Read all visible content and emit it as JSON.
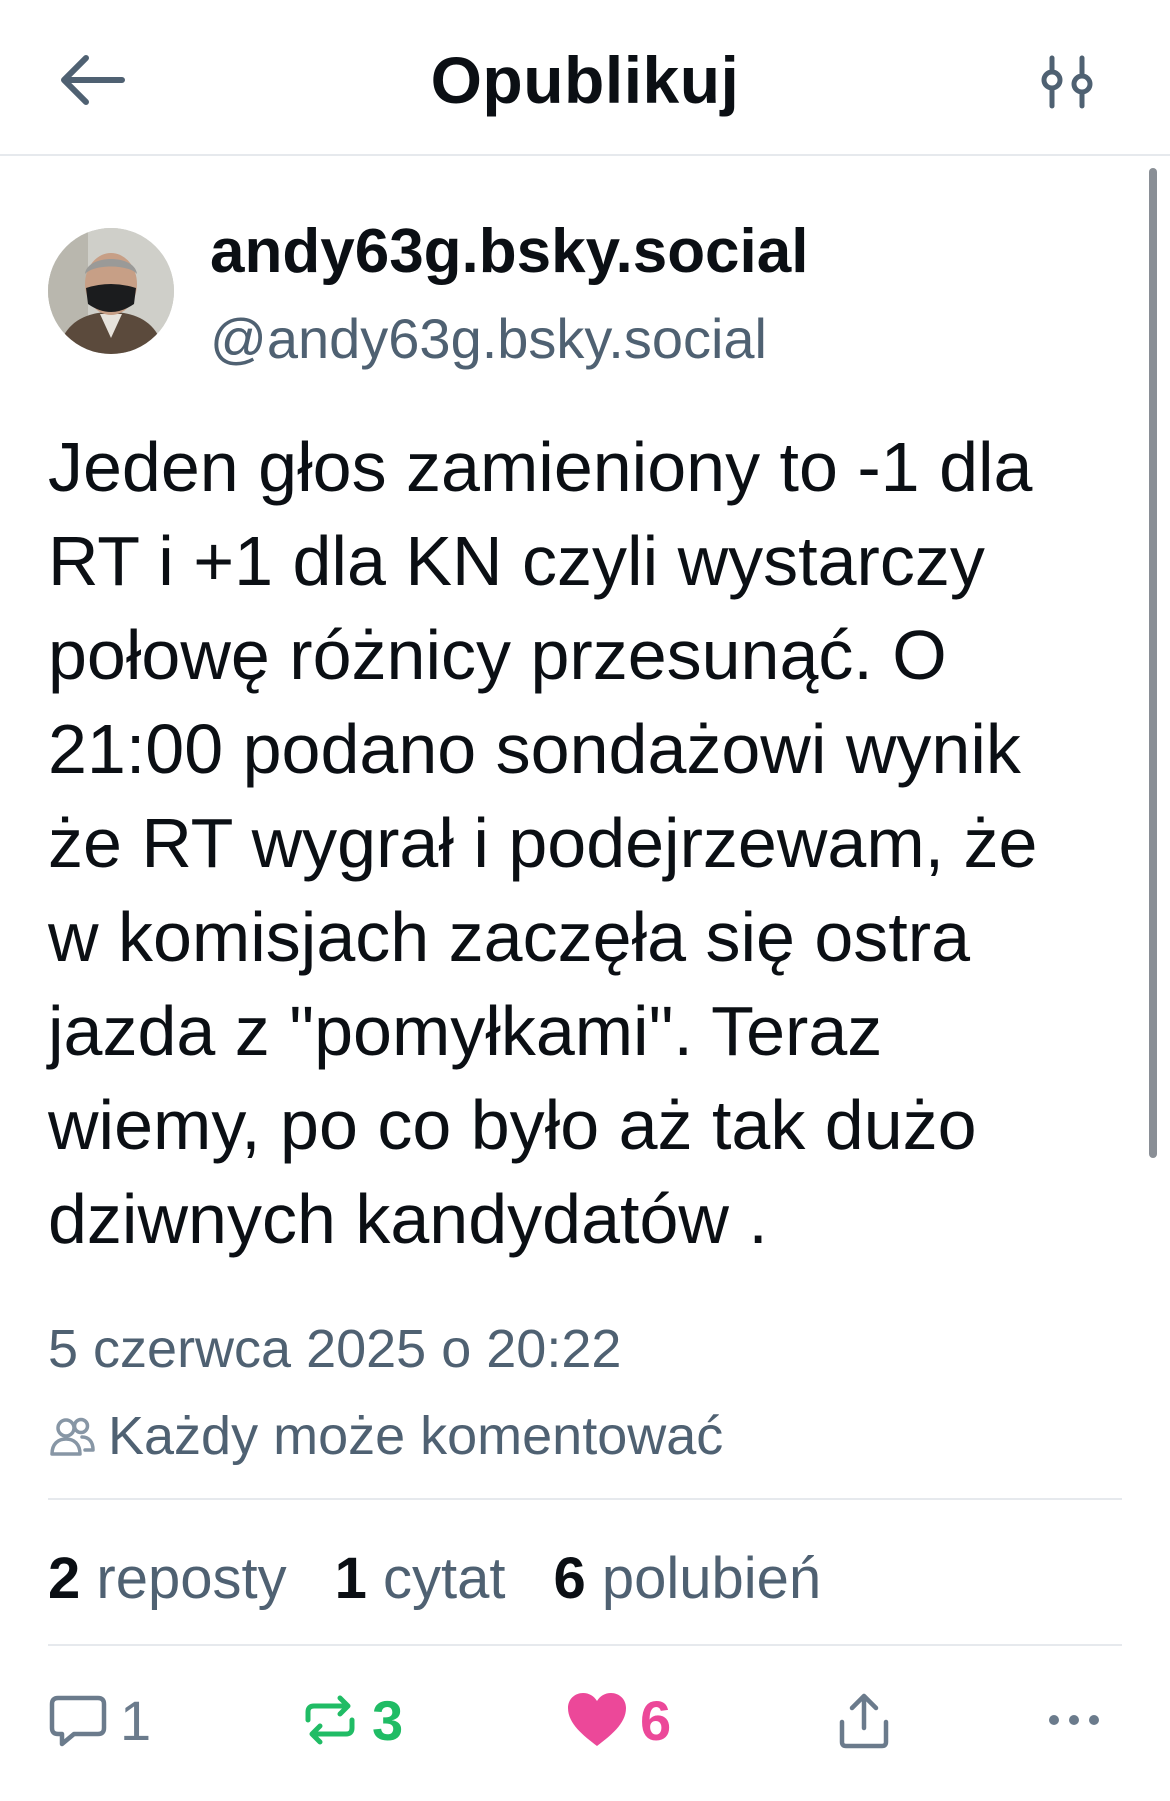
{
  "header": {
    "title": "Opublikuj",
    "back_icon": "arrow-left-icon",
    "filter_icon": "sliders-icon"
  },
  "post": {
    "author": {
      "display_name": "andy63g.bsky.social",
      "handle": "@andy63g.bsky.social"
    },
    "text": "Jeden głos zamieniony to -1 dla\nRT i +1 dla KN czyli wystarczy\npołowę różnicy przesunąć. O\n21:00 podano sondażowi wynik\nże RT wygrał i podejrzewam, że\nw komisjach zaczęła się ostra\njazda z \"pomyłkami\". Teraz\nwiemy, po co było aż tak dużo\ndziwnych kandydatów .",
    "timestamp": "5 czerwca 2025 o 20:22",
    "reply_setting": "Każdy może komentować",
    "stats": {
      "reposts_count": "2",
      "reposts_label": "reposty",
      "quotes_count": "1",
      "quotes_label": "cytat",
      "likes_count": "6",
      "likes_label": "polubień"
    },
    "actions": {
      "reply_count": "1",
      "repost_count": "3",
      "like_count": "6"
    }
  },
  "colors": {
    "text_primary": "#0b0f14",
    "text_secondary": "#4f6172",
    "repost_green": "#20bc65",
    "like_pink": "#ec4899",
    "divider": "#e6e9ed"
  }
}
